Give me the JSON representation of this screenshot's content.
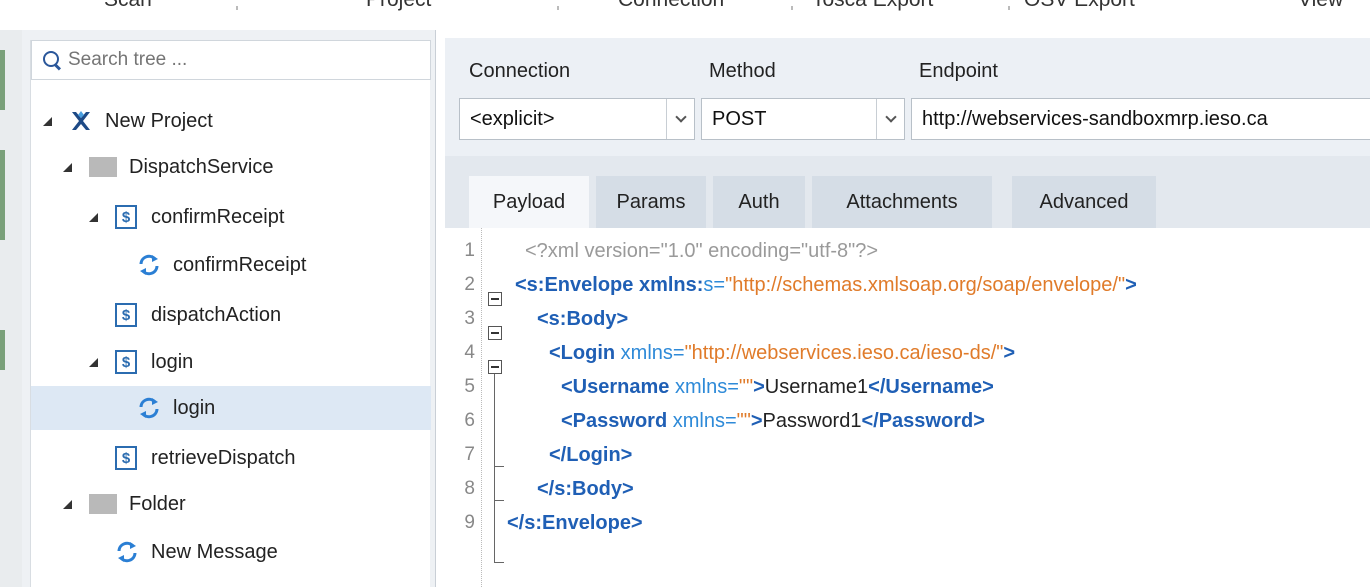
{
  "menu": [
    "Scan",
    "Project",
    "Connection",
    "Tosca Export",
    "OSV Export",
    "View"
  ],
  "tree": {
    "search_placeholder": "Search tree ...",
    "nodes": [
      {
        "label": "New Project"
      },
      {
        "label": "DispatchService"
      },
      {
        "label": "confirmReceipt"
      },
      {
        "label": "confirmReceipt"
      },
      {
        "label": "dispatchAction"
      },
      {
        "label": "login"
      },
      {
        "label": "login"
      },
      {
        "label": "retrieveDispatch"
      },
      {
        "label": "Folder"
      },
      {
        "label": "New Message"
      }
    ]
  },
  "connection": {
    "connection_label": "Connection",
    "method_label": "Method",
    "endpoint_label": "Endpoint",
    "connection_value": "<explicit>",
    "method_value": "POST",
    "endpoint_value": "http://webservices-sandboxmrp.ieso.ca"
  },
  "tabs": [
    "Payload",
    "Params",
    "Auth",
    "Attachments",
    "Advanced"
  ],
  "active_tab": "Payload",
  "editor": {
    "line_numbers": [
      "1",
      "2",
      "3",
      "4",
      "5",
      "6",
      "7",
      "8",
      "9"
    ],
    "l1": "<?xml version=\"1.0\" encoding=\"utf-8\"?>",
    "l2_tag": "<s:Envelope",
    "l2_attr_bold": " xmlns:",
    "l2_attr": "s=",
    "l2_val": "\"http://schemas.xmlsoap.org/soap/envelope/\"",
    "l2_close": ">",
    "l3": "<s:Body>",
    "l4_tag": "<Login",
    "l4_attr": " xmlns=",
    "l4_val": "\"http://webservices.ieso.ca/ieso-ds/\"",
    "l4_close": ">",
    "l5_tag": "<Username",
    "l5_attr": " xmlns=",
    "l5_val": "\"\"",
    "l5_close": ">",
    "l5_text": "Username1",
    "l5_end": "</Username>",
    "l6_tag": "<Password",
    "l6_attr": " xmlns=",
    "l6_val": "\"\"",
    "l6_close": ">",
    "l6_text": "Password1",
    "l6_end": "</Password>",
    "l7": "</Login>",
    "l8": "</s:Body>",
    "l9": "</s:Envelope>"
  },
  "colors": {
    "tag": "#1f5fb5",
    "attr": "#2e8ad8",
    "value": "#e07b2a",
    "selection": "#dde8f4"
  }
}
